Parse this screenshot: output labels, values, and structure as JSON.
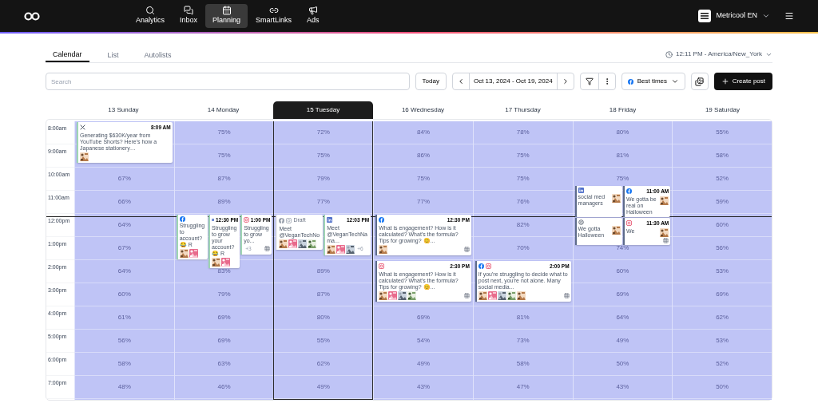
{
  "nav": {
    "items": [
      {
        "label": "Analytics",
        "selected": false
      },
      {
        "label": "Inbox",
        "selected": false
      },
      {
        "label": "Planning",
        "selected": true
      },
      {
        "label": "SmartLinks",
        "selected": false
      },
      {
        "label": "Ads",
        "selected": false
      }
    ],
    "account": "Metricool EN"
  },
  "tabs": [
    {
      "label": "Calendar",
      "selected": true
    },
    {
      "label": "List",
      "selected": false
    },
    {
      "label": "Autolists",
      "selected": false
    }
  ],
  "timezone": "12:11 PM - America/New_York",
  "toolbar": {
    "search_placeholder": "Search",
    "today": "Today",
    "range": "Oct 13, 2024 - Oct 19, 2024",
    "best_times": "Best times",
    "create": "Create post"
  },
  "hours": [
    "8:00am",
    "9:00am",
    "10:00am",
    "11:00am",
    "12:00pm",
    "1:00pm",
    "2:00pm",
    "3:00pm",
    "4:00pm",
    "5:00pm",
    "6:00pm",
    "7:00pm"
  ],
  "days": [
    {
      "label": "13 Sunday",
      "selected": false,
      "cells": [
        {
          "posts": [
            {
              "networks": [
                {
                  "kind": "x"
                }
              ],
              "time": "8:09 AM",
              "text": "Generating $630K/year from YouTube Shorts? Here's how a Japanese stationery…",
              "color": "#9fd6b2",
              "media": [
                {
                  "kind": "picture"
                }
              ]
            }
          ]
        },
        {},
        {
          "value": "67%"
        },
        {
          "value": "66%"
        },
        {
          "value": "64%"
        },
        {
          "value": "67%"
        },
        {
          "value": "64%"
        },
        {
          "value": "60%"
        },
        {
          "value": "61%"
        },
        {
          "value": "56%"
        },
        {
          "value": "58%"
        },
        {
          "value": "48%"
        }
      ]
    },
    {
      "label": "14 Monday",
      "selected": false,
      "cells": [
        {
          "value": "75%"
        },
        {
          "value": "75%"
        },
        {
          "value": "87%"
        },
        {
          "value": "89%"
        },
        {
          "posts": [
            {
              "networks": [
                {
                  "kind": "facebook"
                }
              ],
              "text": "Struggling to account? 😂 R",
              "color": "#9fd6b2",
              "media": [
                {
                  "kind": "picture"
                },
                {
                  "kind": "picture"
                }
              ]
            },
            {
              "networks": [
                {
                  "kind": "linkedin"
                }
              ],
              "time": "12:30 PM",
              "text": "Struggling to grow your account? 😂 R",
              "color": "#9fd6b2",
              "media": [
                {
                  "kind": "picture"
                },
                {
                  "kind": "picture"
                }
              ]
            },
            {
              "networks": [
                {
                  "kind": "instagram"
                }
              ],
              "time": "1:00 PM",
              "text": "Struggling to grow yo...",
              "color": "#9fd6b2",
              "more": "+3",
              "grid": true
            }
          ]
        },
        {},
        {
          "value": "83%"
        },
        {
          "value": "79%"
        },
        {
          "value": "69%"
        },
        {
          "value": "69%"
        },
        {
          "value": "63%"
        },
        {
          "value": "46%"
        }
      ]
    },
    {
      "label": "15 Tuesday",
      "selected": true,
      "cells": [
        {
          "value": "72%"
        },
        {
          "value": "75%"
        },
        {
          "value": "79%"
        },
        {
          "value": "77%"
        },
        {
          "posts": [
            {
              "networks": [
                {
                  "kind": "facebook"
                },
                {
                  "kind": "instagram"
                }
              ],
              "draft": true,
              "status": "Draft",
              "text": "Meet @VeganTechNo",
              "color": "#e5e7eb",
              "media": [
                {
                  "kind": "picture"
                },
                {
                  "kind": "picture"
                },
                {
                  "kind": "picture"
                },
                {
                  "kind": "picture"
                }
              ]
            },
            {
              "networks": [
                {
                  "kind": "linkedin"
                }
              ],
              "time": "12:03 PM",
              "text": "Meet @VeganTechNama...",
              "color": "#9fd6b2",
              "media": [
                {
                  "kind": "picture"
                },
                {
                  "kind": "picture"
                },
                {
                  "kind": "picture"
                }
              ],
              "more": "+6"
            }
          ]
        },
        {},
        {
          "value": "89%"
        },
        {
          "value": "87%"
        },
        {
          "value": "80%"
        },
        {
          "value": "55%"
        },
        {
          "value": "62%"
        },
        {
          "value": "49%"
        }
      ]
    },
    {
      "label": "16 Wednesday",
      "selected": false,
      "cells": [
        {
          "value": "84%"
        },
        {
          "value": "86%"
        },
        {
          "value": "75%"
        },
        {
          "value": "77%"
        },
        {
          "posts": [
            {
              "networks": [
                {
                  "kind": "facebook"
                }
              ],
              "time": "12:30 PM",
              "text": "What is engagement? How is it calculated? What's the formula? Tips for growing? 😊...",
              "color": "#5d6b8a",
              "media": [
                {
                  "kind": "picture"
                }
              ],
              "grid": true
            }
          ]
        },
        {},
        {
          "posts": [
            {
              "networks": [
                {
                  "kind": "instagram"
                }
              ],
              "time": "2:30 PM",
              "text": "What is engagement? How is it calculated? What's the formula? Tips for growing? 😊...",
              "color": "#5d6b8a",
              "media": [
                {
                  "kind": "picture"
                },
                {
                  "kind": "picture"
                },
                {
                  "kind": "picture"
                },
                {
                  "kind": "picture"
                }
              ],
              "grid": true
            }
          ]
        },
        {},
        {
          "value": "69%"
        },
        {
          "value": "54%"
        },
        {
          "value": "49%"
        },
        {
          "value": "43%"
        }
      ]
    },
    {
      "label": "17 Thursday",
      "selected": false,
      "cells": [
        {
          "value": "78%"
        },
        {
          "value": "75%"
        },
        {
          "value": "75%"
        },
        {
          "value": "76%"
        },
        {
          "value": "82%"
        },
        {
          "value": "70%"
        },
        {
          "posts": [
            {
              "networks": [
                {
                  "kind": "facebook"
                },
                {
                  "kind": "instagram"
                }
              ],
              "time": "2:00 PM",
              "text": "If you're struggling to decide what to post next, you're not alone. Many social media...",
              "color": "#5d6b8a",
              "media": [
                {
                  "kind": "picture"
                },
                {
                  "kind": "picture"
                },
                {
                  "kind": "picture"
                },
                {
                  "kind": "picture"
                },
                {
                  "kind": "picture"
                }
              ],
              "grid": true
            }
          ]
        },
        {},
        {
          "value": "81%"
        },
        {
          "value": "73%"
        },
        {
          "value": "58%"
        },
        {
          "value": "47%"
        }
      ]
    },
    {
      "label": "18 Friday",
      "selected": false,
      "cells": [
        {
          "value": "80%"
        },
        {
          "value": "81%"
        },
        {
          "value": "75%"
        },
        {
          "posts": [
            {
              "networks": [
                {
                  "kind": "linkedin"
                }
              ],
              "text": "social med managers",
              "color": "#5d6b8a",
              "media": [
                {
                  "kind": "picture"
                }
              ]
            },
            {
              "networks": [
                {
                  "kind": "facebook"
                }
              ],
              "time": "11:00 AM",
              "text": "We gotta be real on Halloween",
              "color": "#5d6b8a",
              "media": [
                {
                  "kind": "picture"
                }
              ]
            },
            {
              "networks": [
                {
                  "kind": "threads"
                }
              ],
              "text": "We gotta Halloween",
              "color": "#5d6b8a",
              "media": [
                {
                  "kind": "picture"
                }
              ]
            },
            {
              "networks": [
                {
                  "kind": "instagram"
                }
              ],
              "time": "11:30 AM",
              "text": "We",
              "color": "#5d6b8a",
              "media": [
                {
                  "kind": "picture"
                }
              ],
              "grid": true
            }
          ]
        },
        {},
        {
          "value": "74%"
        },
        {
          "value": "60%"
        },
        {
          "value": "69%"
        },
        {
          "value": "64%"
        },
        {
          "value": "49%"
        },
        {
          "value": "50%"
        },
        {
          "value": "43%"
        }
      ]
    },
    {
      "label": "19 Saturday",
      "selected": false,
      "cells": [
        {
          "value": "55%"
        },
        {
          "value": "58%"
        },
        {
          "value": "52%"
        },
        {
          "value": "59%"
        },
        {
          "value": "60%"
        },
        {
          "value": "56%"
        },
        {
          "value": "53%"
        },
        {
          "value": "69%"
        },
        {
          "value": "62%"
        },
        {
          "value": "53%"
        },
        {
          "value": "52%"
        },
        {
          "value": "50%"
        }
      ]
    }
  ]
}
